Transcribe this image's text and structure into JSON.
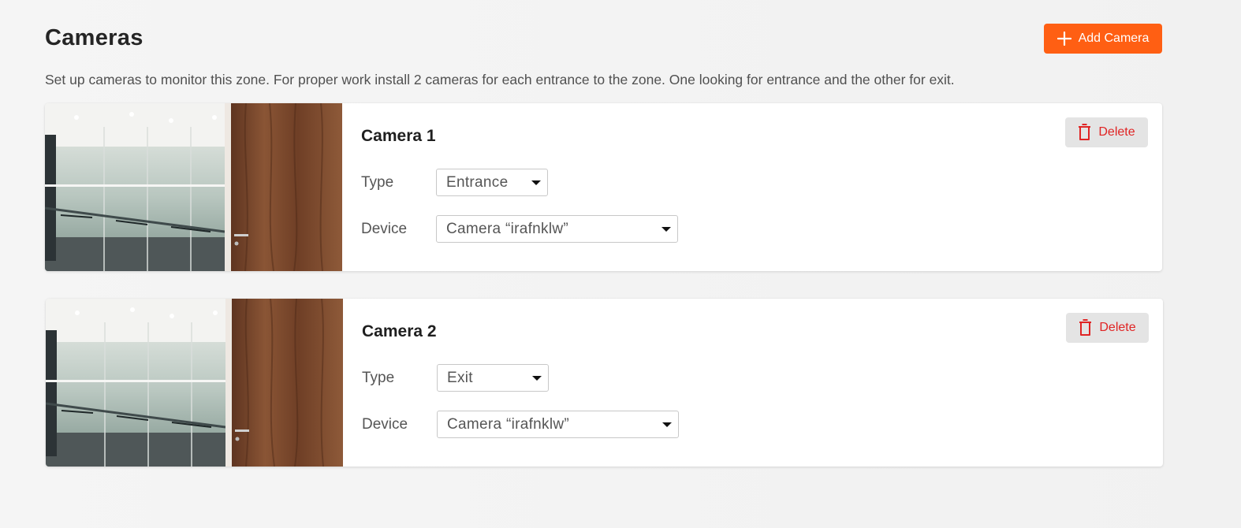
{
  "page": {
    "title": "Cameras",
    "description": "Set up cameras to monitor this zone. For proper work install 2 cameras for each entrance to the zone. One looking for entrance and the other for exit.",
    "add_button_label": "Add Camera",
    "add_button_icon": "plus-icon"
  },
  "colors": {
    "accent": "#ff5f13",
    "danger": "#e02424",
    "delete_bg": "#e4e4e4"
  },
  "cameras": [
    {
      "title": "Camera 1",
      "type_label": "Type",
      "type_value": "Entrance",
      "device_label": "Device",
      "device_value": "Camera “irafnklw”",
      "delete_label": "Delete",
      "delete_icon": "trash-icon"
    },
    {
      "title": "Camera 2",
      "type_label": "Type",
      "type_value": "Exit",
      "device_label": "Device",
      "device_value": "Camera “irafnklw”",
      "delete_label": "Delete",
      "delete_icon": "trash-icon"
    }
  ]
}
